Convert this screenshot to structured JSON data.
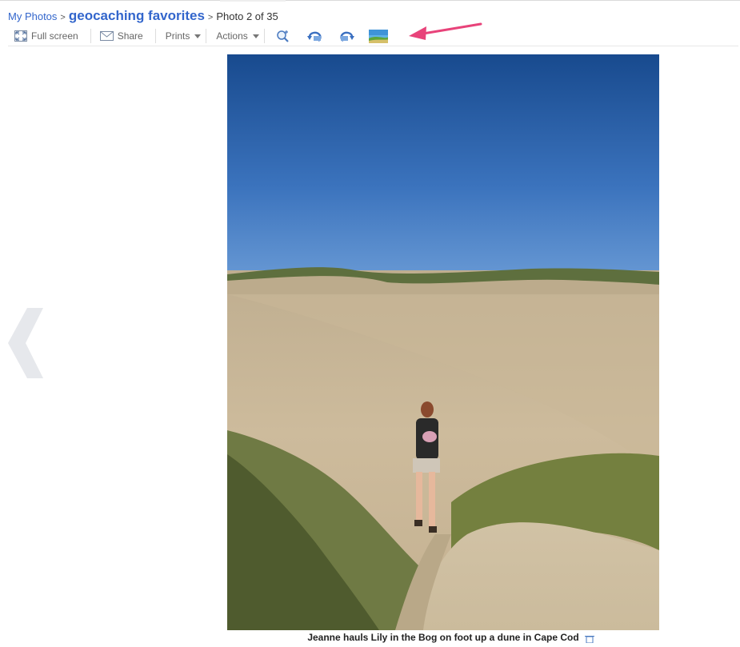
{
  "breadcrumb": {
    "root_label": "My Photos",
    "separator": ">",
    "album_title": "geocaching favorites",
    "position_text": "Photo 2 of 35"
  },
  "toolbar": {
    "fullscreen_label": "Full screen",
    "share_label": "Share",
    "prints_label": "Prints",
    "actions_label": "Actions",
    "icons": [
      "fullscreen-icon",
      "mail-icon",
      "zoom-in-icon",
      "rotate-left-icon",
      "rotate-right-icon",
      "set-as-cover-icon"
    ]
  },
  "photo": {
    "caption": "Jeanne hauls Lily in the Bog on foot up a dune in Cape Cod"
  },
  "colors": {
    "link": "#3366cc",
    "annotation_arrow": "#e8437a",
    "sky_top": "#184a8e",
    "sky_bottom": "#6f9fd8",
    "sand": "#c8b595"
  }
}
